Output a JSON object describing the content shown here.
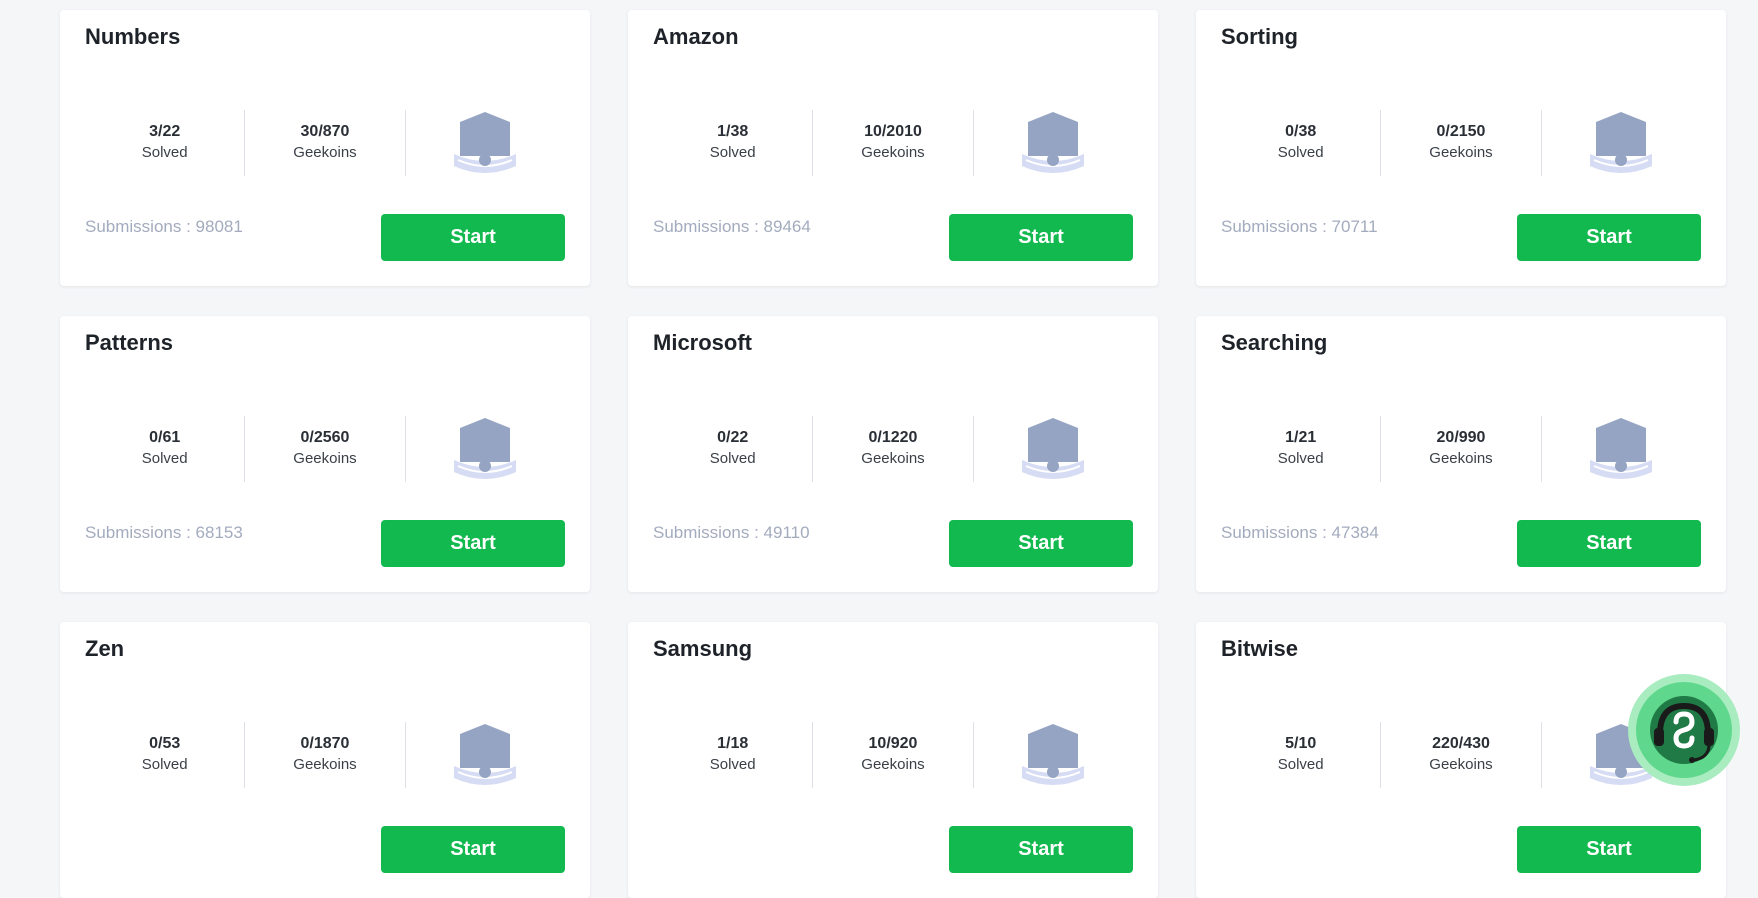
{
  "cards": [
    {
      "title": "Numbers",
      "solved": "3/22",
      "solved_label": "Solved",
      "geekoins": "30/870",
      "geekoins_label": "Geekoins",
      "submissions": "Submissions : 98081",
      "button": "Start"
    },
    {
      "title": "Amazon",
      "solved": "1/38",
      "solved_label": "Solved",
      "geekoins": "10/2010",
      "geekoins_label": "Geekoins",
      "submissions": "Submissions : 89464",
      "button": "Start"
    },
    {
      "title": "Sorting",
      "solved": "0/38",
      "solved_label": "Solved",
      "geekoins": "0/2150",
      "geekoins_label": "Geekoins",
      "submissions": "Submissions : 70711",
      "button": "Start"
    },
    {
      "title": "Patterns",
      "solved": "0/61",
      "solved_label": "Solved",
      "geekoins": "0/2560",
      "geekoins_label": "Geekoins",
      "submissions": "Submissions : 68153",
      "button": "Start"
    },
    {
      "title": "Microsoft",
      "solved": "0/22",
      "solved_label": "Solved",
      "geekoins": "0/1220",
      "geekoins_label": "Geekoins",
      "submissions": "Submissions : 49110",
      "button": "Start"
    },
    {
      "title": "Searching",
      "solved": "1/21",
      "solved_label": "Solved",
      "geekoins": "20/990",
      "geekoins_label": "Geekoins",
      "submissions": "Submissions : 47384",
      "button": "Start"
    },
    {
      "title": "Zen",
      "solved": "0/53",
      "solved_label": "Solved",
      "geekoins": "0/1870",
      "geekoins_label": "Geekoins",
      "submissions": "",
      "button": "Start"
    },
    {
      "title": "Samsung",
      "solved": "1/18",
      "solved_label": "Solved",
      "geekoins": "10/920",
      "geekoins_label": "Geekoins",
      "submissions": "",
      "button": "Start"
    },
    {
      "title": "Bitwise",
      "solved": "5/10",
      "solved_label": "Solved",
      "geekoins": "220/430",
      "geekoins_label": "Geekoins",
      "submissions": "",
      "button": "Start"
    }
  ],
  "icons": {
    "badge": "badge-icon",
    "support": "support-headset-icon"
  },
  "colors": {
    "accent": "#12b94f",
    "badge": "#95a4c2",
    "badge_ribbon": "#d5dcf4",
    "help_bg": "#5fd88d",
    "help_ring": "#a9ecc0"
  }
}
